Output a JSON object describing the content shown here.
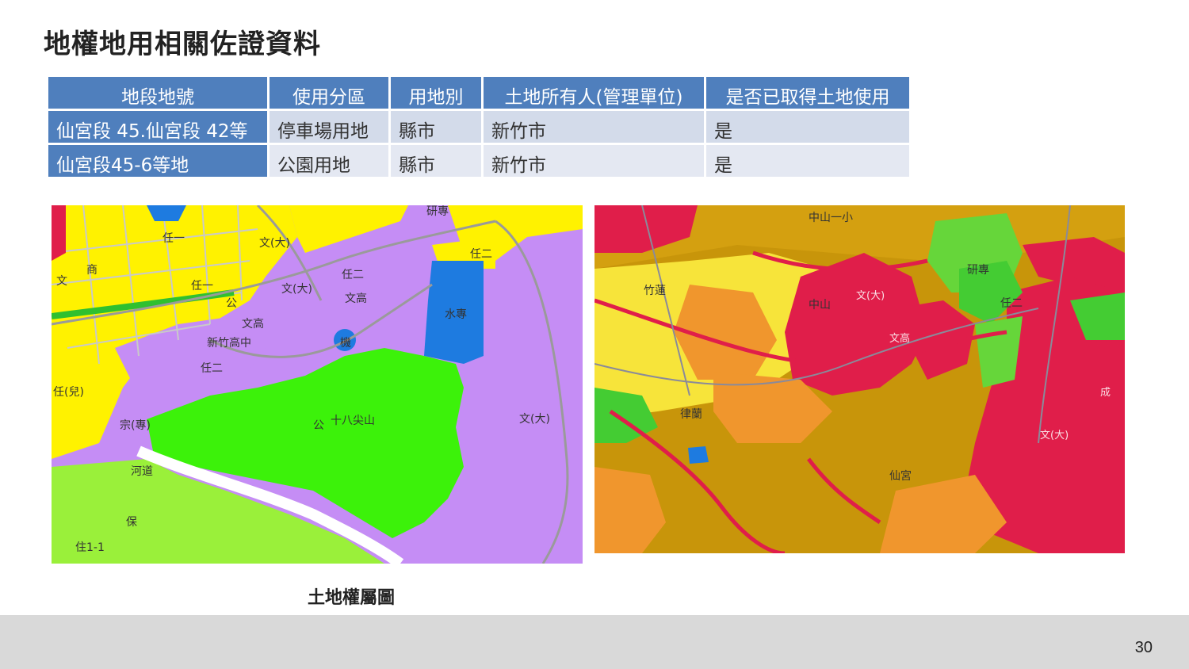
{
  "title": "地權地用相關佐證資料",
  "table": {
    "headers": [
      "地段地號",
      "使用分區",
      "用地別",
      "土地所有人(管理單位)",
      "是否已取得土地使用"
    ],
    "rows": [
      [
        "仙宮段 45.仙宮段 42等",
        "停車場用地",
        "縣市",
        "新竹市",
        "是"
      ],
      [
        "仙宮段45-6等地",
        "公園用地",
        "縣市",
        "新竹市",
        "是"
      ]
    ]
  },
  "map_left": {
    "labels": [
      "任二",
      "任一",
      "文(大)",
      "研專",
      "文",
      "商",
      "任一",
      "文(大)",
      "任二",
      "文高",
      "公",
      "文高",
      "機",
      "水專",
      "新竹高中",
      "任二",
      "任(兒)",
      "宗(專)",
      "公",
      "十八尖山",
      "文(大)",
      "河道",
      "保",
      "住1-1"
    ]
  },
  "map_right": {
    "labels": [
      "中山一小",
      "竹蓮",
      "中山",
      "文(大)",
      "研專",
      "任二",
      "文高",
      "文(大)",
      "仙宮",
      "成",
      "律蘭"
    ]
  },
  "caption": "土地權屬圖",
  "page_number": "30",
  "colors": {
    "header_blue": "#4f7fbd",
    "row_light": "#e4e8f2",
    "map_purple": "#c58df5",
    "map_green": "#3cf20a",
    "map_yellow": "#fff200",
    "map_blue": "#1e7be0",
    "map_red": "#e01e4a",
    "map_olive": "#c8950a",
    "map_orange": "#f0962d"
  }
}
